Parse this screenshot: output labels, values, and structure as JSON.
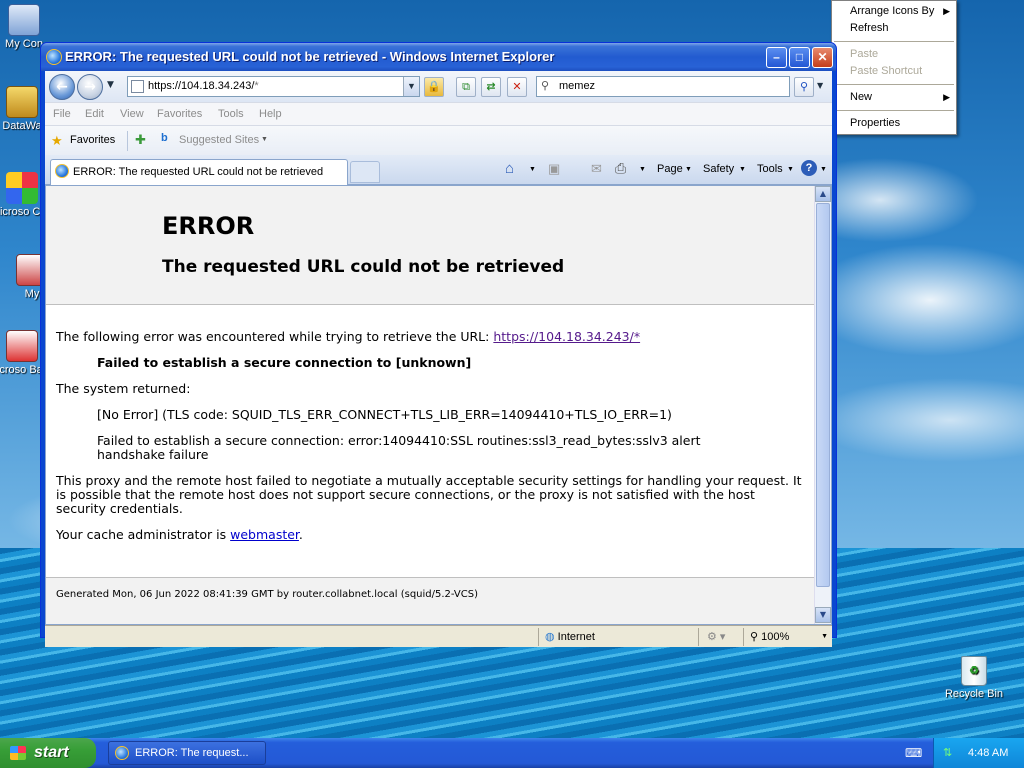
{
  "desktop": {
    "icons": [
      {
        "label": "My Con",
        "icon": "my-computer-icon"
      },
      {
        "label": "DataWa",
        "icon": "shortcut-icon"
      },
      {
        "label": "Microso C++",
        "icon": "shortcut-icon"
      },
      {
        "label": "My",
        "icon": "shortcut-icon"
      },
      {
        "label": "Microso Basic",
        "icon": "shortcut-icon"
      },
      {
        "label": "Recycle Bin",
        "icon": "recycle-bin-icon"
      }
    ],
    "context_menu": {
      "arrange": "Arrange Icons By",
      "refresh": "Refresh",
      "paste": "Paste",
      "paste_shortcut": "Paste Shortcut",
      "new": "New",
      "properties": "Properties"
    }
  },
  "window": {
    "title": "ERROR: The requested URL could not be retrieved - Windows Internet Explorer",
    "address_host": "https://104.18.34.243/",
    "address_rest": "*",
    "search_text": "memez",
    "menu": [
      "File",
      "Edit",
      "View",
      "Favorites",
      "Tools",
      "Help"
    ],
    "favorites_label": "Favorites",
    "suggested_sites": "Suggested Sites",
    "tab_title": "ERROR: The requested URL could not be retrieved",
    "commands": {
      "page": "Page",
      "safety": "Safety",
      "tools": "Tools"
    }
  },
  "page": {
    "h1": "ERROR",
    "h2": "The requested URL could not be retrieved",
    "intro": "The following error was encountered while trying to retrieve the URL:",
    "url": "https://104.18.34.243/*",
    "fail": "Failed to establish a secure connection to [unknown]",
    "system_returned": "The system returned:",
    "no_error": "[No Error] (TLS code: SQUID_TLS_ERR_CONNECT+TLS_LIB_ERR=14094410+TLS_IO_ERR=1)",
    "ssl_line1": "Failed to establish a secure connection: error:14094410:SSL routines:ssl3_read_bytes:sslv3 alert",
    "ssl_line2": "handshake failure",
    "para1": "This proxy and the remote host failed to negotiate a mutually acceptable security settings for handling your request. It",
    "para2": "is possible that the remote host does not support secure connections, or the proxy is not satisfied with the host",
    "para3": "security credentials.",
    "admin_prefix": "Your cache administrator is",
    "admin_link": "webmaster",
    "admin_suffix": ".",
    "footer": "Generated Mon, 06 Jun 2022 08:41:39 GMT by router.collabnet.local (squid/5.2-VCS)"
  },
  "status": {
    "zone": "Internet",
    "zoom": "100%"
  },
  "taskbar": {
    "start": "start",
    "item": "ERROR: The request...",
    "clock": "4:48 AM"
  }
}
